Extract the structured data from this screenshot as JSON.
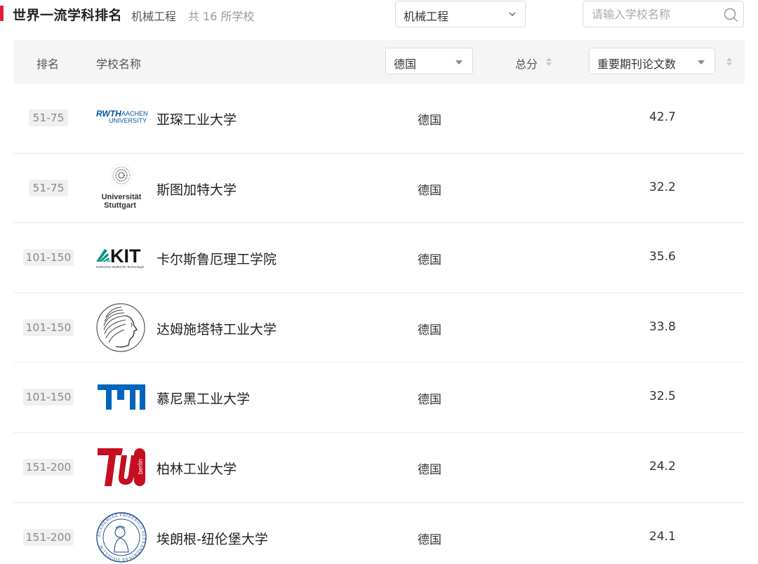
{
  "header": {
    "title": "世界一流学科排名",
    "subject": "机械工程",
    "count_text": "共 16 所学校",
    "subject_select": "机械工程",
    "search_placeholder": "请输入学校名称",
    "accent_color": "#e0203a"
  },
  "table": {
    "headers": {
      "rank": "排名",
      "name": "学校名称",
      "country_filter": "德国",
      "total": "总分",
      "metric_filter": "重要期刊论文数"
    },
    "rows": [
      {
        "rank": "51-75",
        "name": "亚琛工业大学",
        "country": "德国",
        "score": "42.7",
        "logo": "rwth-aachen-logo",
        "logo_text": [
          "RWTH",
          "AACHEN",
          "UNIVERSITY"
        ]
      },
      {
        "rank": "51-75",
        "name": "斯图加特大学",
        "country": "德国",
        "score": "32.2",
        "logo": "stuttgart-logo",
        "logo_text": [
          "Universität",
          "Stuttgart"
        ]
      },
      {
        "rank": "101-150",
        "name": "卡尔斯鲁厄理工学院",
        "country": "德国",
        "score": "35.6",
        "logo": "kit-logo",
        "logo_text": [
          "KIT",
          "Karlsruher Institut für Technologie"
        ]
      },
      {
        "rank": "101-150",
        "name": "达姆施塔特工业大学",
        "country": "德国",
        "score": "33.8",
        "logo": "tu-darmstadt-athena-logo",
        "logo_text": []
      },
      {
        "rank": "101-150",
        "name": "慕尼黑工业大学",
        "country": "德国",
        "score": "32.5",
        "logo": "tum-logo",
        "logo_text": []
      },
      {
        "rank": "151-200",
        "name": "柏林工业大学",
        "country": "德国",
        "score": "24.2",
        "logo": "tu-berlin-logo",
        "logo_text": [
          "berlin"
        ]
      },
      {
        "rank": "151-200",
        "name": "埃朗根-纽伦堡大学",
        "country": "德国",
        "score": "24.1",
        "logo": "fau-seal-logo",
        "logo_text": [
          "ACADEMIAE FRIDERICO ALEXANDRINAE SIGILLUM"
        ]
      }
    ]
  }
}
